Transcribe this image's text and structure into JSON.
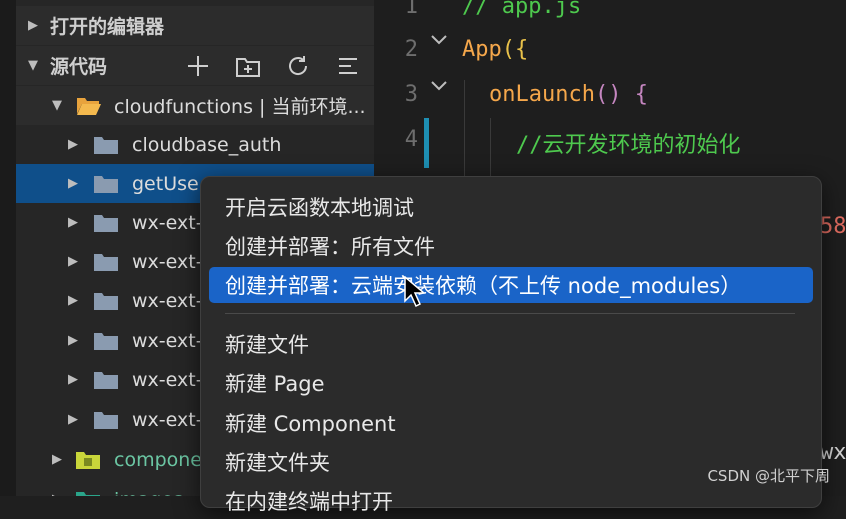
{
  "sidebar": {
    "open_editors": "打开的编辑器",
    "source_code": "源代码",
    "toolbar_icons": [
      "plus-icon",
      "new-folder-icon",
      "refresh-icon",
      "collapse-icon"
    ],
    "tree": [
      {
        "label": "cloudfunctions | 当前环境...",
        "depth": 1,
        "expanded": true
      },
      {
        "label": "cloudbase_auth",
        "depth": 2
      },
      {
        "label": "getUse",
        "depth": 2,
        "selected": true
      },
      {
        "label": "wx-ext-",
        "depth": 2
      },
      {
        "label": "wx-ext-",
        "depth": 2
      },
      {
        "label": "wx-ext-",
        "depth": 2
      },
      {
        "label": "wx-ext-",
        "depth": 2
      },
      {
        "label": "wx-ext-",
        "depth": 2
      },
      {
        "label": "wx-ext-",
        "depth": 2
      },
      {
        "label": "compone",
        "depth": 1,
        "kind": "component-folder"
      },
      {
        "label": "images",
        "depth": 1,
        "kind": "images-folder"
      }
    ]
  },
  "editor": {
    "line_numbers": [
      "1",
      "2",
      "3",
      "4"
    ],
    "line1": "// app.js",
    "line2_fn": "App",
    "line2_rest": "({",
    "line3_fn": "onLaunch",
    "line3_rest": "() {",
    "line4": "//云开发环境的初始化",
    "clipped_red": "58",
    "clipped_right": "wx"
  },
  "context_menu": {
    "items": [
      "开启云函数本地调试",
      "创建并部署：所有文件",
      "创建并部署：云端安装依赖（不上传 node_modules）",
      "新建文件",
      "新建 Page",
      "新建 Component",
      "新建文件夹",
      "在内建终端中打开"
    ],
    "highlighted_index": 2
  },
  "watermark": "CSDN @北平下周",
  "colors": {
    "selected_row": "#0f4f8a",
    "menu_highlight": "#1a64c8",
    "comment": "#4ec94e",
    "keyword_orange": "#f5a74b"
  }
}
